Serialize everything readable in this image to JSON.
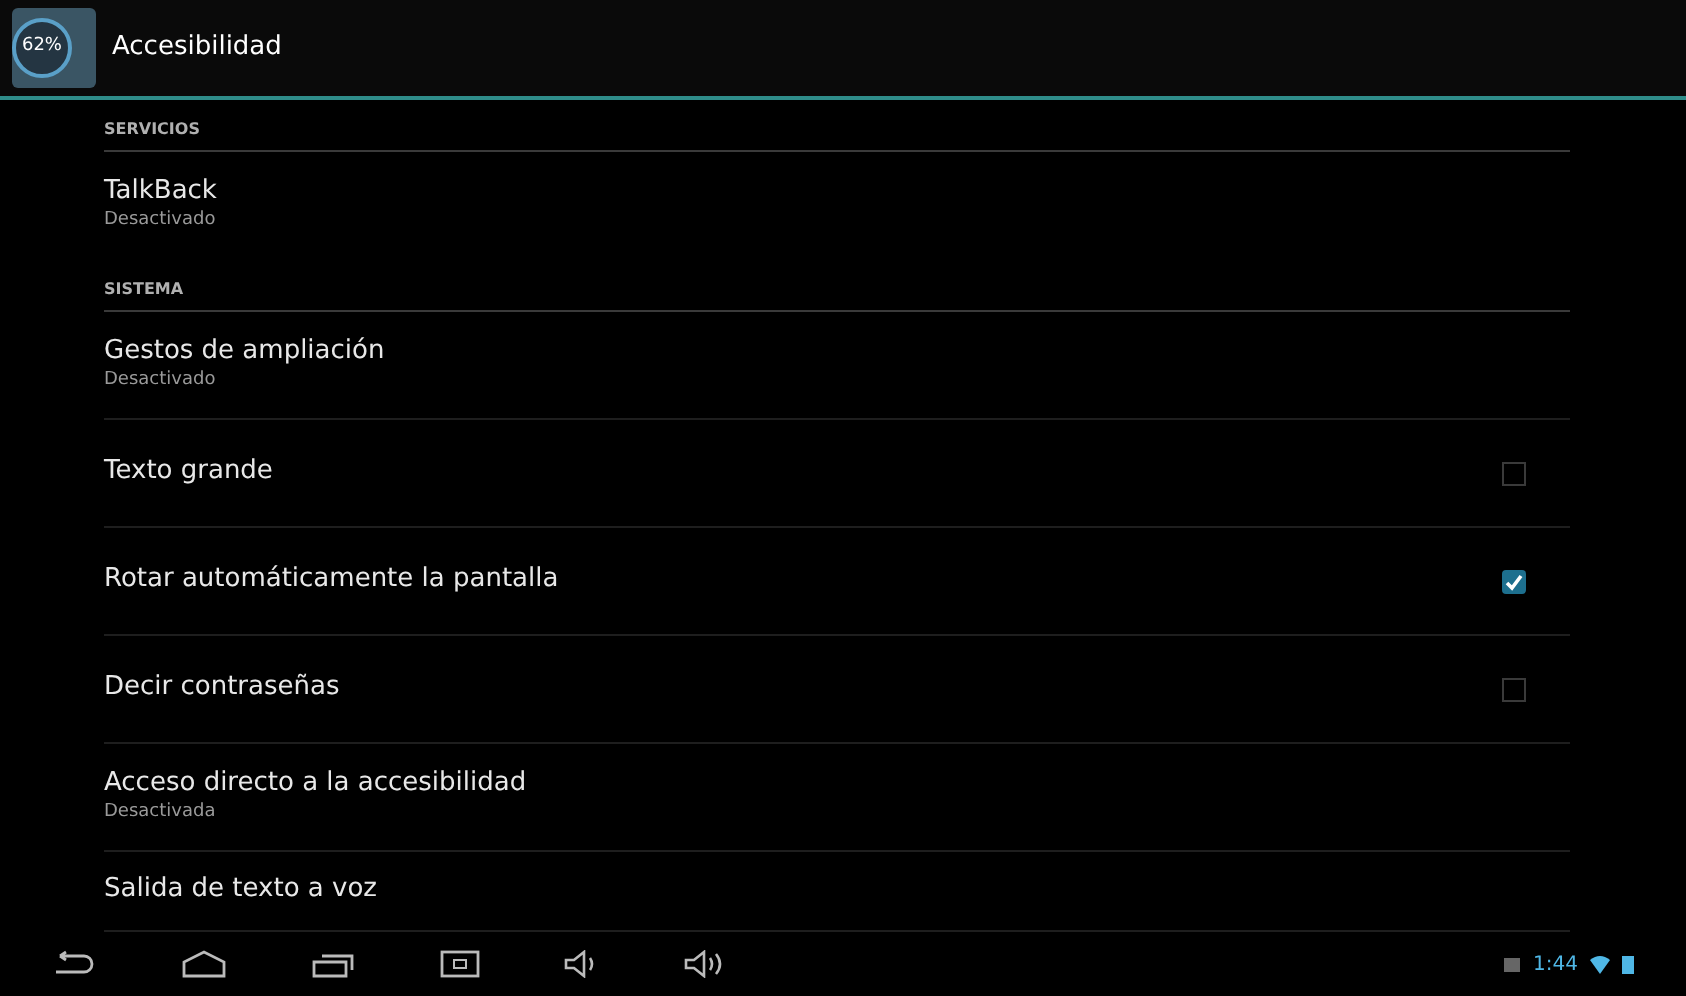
{
  "action_bar": {
    "badge": "62%",
    "title": "Accesibilidad"
  },
  "sections": [
    {
      "header": "SERVICIOS",
      "items": [
        {
          "kind": "subtitle",
          "title": "TalkBack",
          "summary": "Desactivado"
        }
      ]
    },
    {
      "header": "SISTEMA",
      "items": [
        {
          "kind": "subtitle",
          "title": "Gestos de ampliación",
          "summary": "Desactivado"
        },
        {
          "kind": "checkbox",
          "title": "Texto grande",
          "checked": false
        },
        {
          "kind": "checkbox",
          "title": "Rotar automáticamente la pantalla",
          "checked": true
        },
        {
          "kind": "checkbox",
          "title": "Decir contraseñas",
          "checked": false
        },
        {
          "kind": "subtitle",
          "title": "Acceso directo a la accesibilidad",
          "summary": "Desactivada"
        },
        {
          "kind": "plain",
          "title": "Salida de texto a voz"
        }
      ]
    }
  ],
  "status": {
    "time": "1:44"
  }
}
